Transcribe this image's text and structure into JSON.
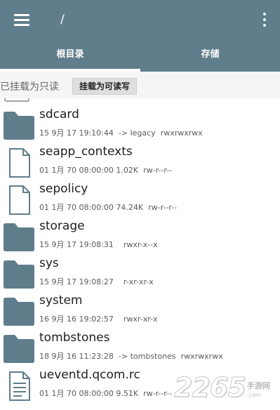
{
  "header": {
    "path": "/",
    "menu_icon": "hamburger-menu-icon",
    "more_icon": "more-vertical-icon",
    "color": "#607d8b"
  },
  "tabs": [
    {
      "label": "根目录",
      "active": true
    },
    {
      "label": "存储",
      "active": false
    }
  ],
  "mount": {
    "status": "已挂载为只读",
    "button": "挂载为可读写"
  },
  "files": [
    {
      "name": "sdcard",
      "type": "folder",
      "date": "15 9月 17 19:10:44",
      "size": "",
      "extra": "-> legacy",
      "perms": "rwxrwxrwx"
    },
    {
      "name": "seapp_contexts",
      "type": "file",
      "date": "01 1月 70 08:00:00",
      "size": "1.02K",
      "extra": "",
      "perms": "rw-r--r--"
    },
    {
      "name": "sepolicy",
      "type": "file",
      "date": "01 1月 70 08:00:00",
      "size": "74.24K",
      "extra": "",
      "perms": "rw-r--r--"
    },
    {
      "name": "storage",
      "type": "folder",
      "date": "15 9月 17 19:08:31",
      "size": "",
      "extra": "",
      "perms": "rwxr-x--x"
    },
    {
      "name": "sys",
      "type": "folder",
      "date": "15 9月 17 19:08:27",
      "size": "",
      "extra": "",
      "perms": "r-xr-xr-x"
    },
    {
      "name": "system",
      "type": "folder",
      "date": "16 9月 16 19:02:57",
      "size": "",
      "extra": "",
      "perms": "rwxr-xr-x"
    },
    {
      "name": "tombstones",
      "type": "folder",
      "date": "18 9月 16 11:23:28",
      "size": "",
      "extra": "-> tombstones",
      "perms": "rwxrwxrwx"
    },
    {
      "name": "ueventd.qcom.rc",
      "type": "text-file",
      "date": "01 1月 70 08:00:00",
      "size": "9.51K",
      "extra": "",
      "perms": "rw-r--r--"
    }
  ],
  "watermark": {
    "number": "2265",
    "name": "手游网",
    "url": ".com"
  }
}
